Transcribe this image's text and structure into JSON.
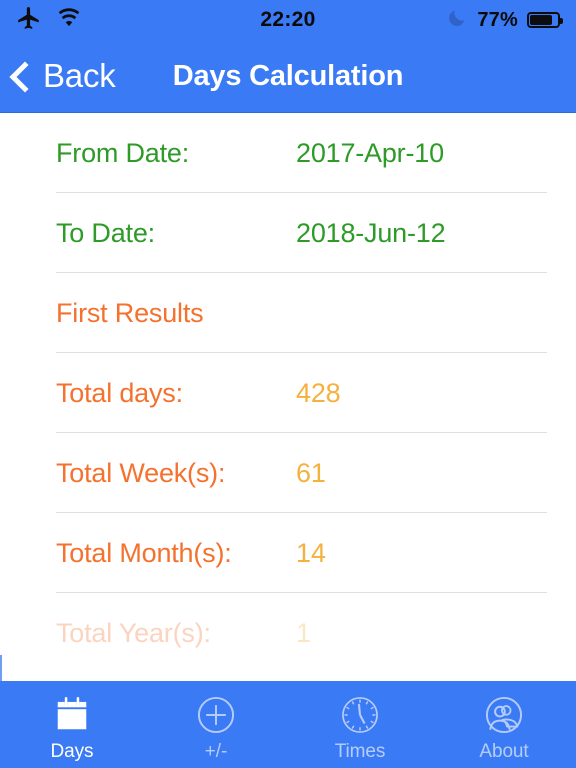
{
  "status_bar": {
    "airplane_icon": "airplane-icon",
    "wifi_icon": "wifi-icon",
    "time": "22:20",
    "dnd_icon": "moon-icon",
    "battery_percent": "77%",
    "battery_level": 77
  },
  "nav": {
    "back_label": "Back",
    "back_icon": "chevron-left-icon",
    "title": "Days Calculation"
  },
  "rows": [
    {
      "label": "From Date:",
      "value": "2017-Apr-10",
      "style": "green"
    },
    {
      "label": "To Date:",
      "value": "2018-Jun-12",
      "style": "green"
    },
    {
      "label": "First Results",
      "value": "",
      "style": "section-head"
    },
    {
      "label": "Total days:",
      "value": "428",
      "style": "result"
    },
    {
      "label": "Total Week(s):",
      "value": "61",
      "style": "result"
    },
    {
      "label": "Total Month(s):",
      "value": "14",
      "style": "result"
    }
  ],
  "cut_off_row": {
    "label": "Total Year(s):",
    "value": "1"
  },
  "tabs": [
    {
      "label": "Days",
      "icon": "calendar-icon",
      "active": true
    },
    {
      "label": "+/-",
      "icon": "plus-circle-icon",
      "active": false
    },
    {
      "label": "Times",
      "icon": "clock-icon",
      "active": false
    },
    {
      "label": "About",
      "icon": "people-icon",
      "active": false
    }
  ],
  "colors": {
    "brand_blue": "#3b7af5",
    "date_green": "#2e9b28",
    "label_orange": "#f5712e",
    "value_amber": "#f5b13d",
    "separator": "#e0e0e0",
    "background": "#ffffff"
  }
}
